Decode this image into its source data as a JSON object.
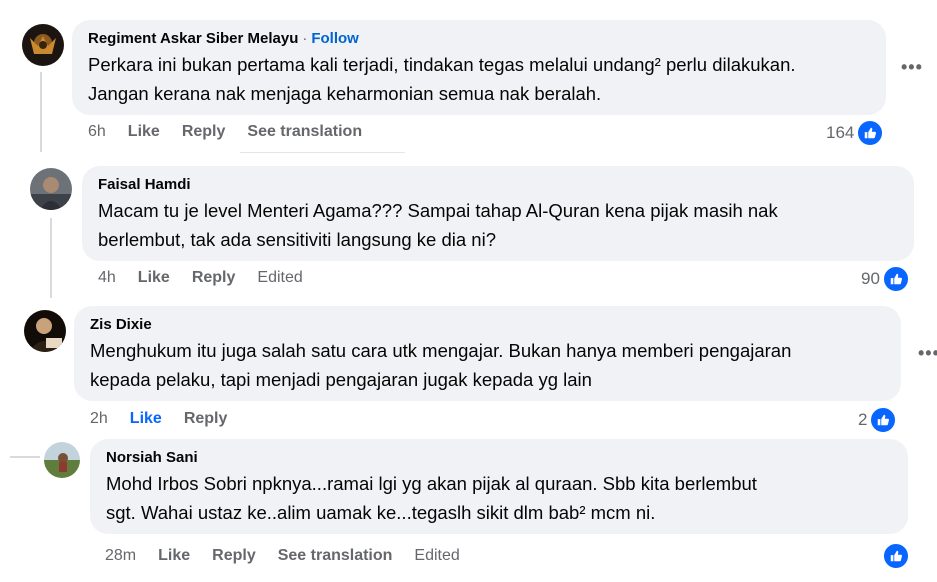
{
  "comments": [
    {
      "author": "Regiment Askar Siber Melayu",
      "follow_sep": "·",
      "follow_label": "Follow",
      "line1": "Perkara ini bukan pertama kali terjadi, tindakan tegas melalui undang² perlu dilakukan.",
      "line2": "Jangan kerana nak menjaga keharmonian semua nak beralah.",
      "time": "6h",
      "actions": [
        "Like",
        "Reply",
        "See translation"
      ],
      "reaction_count": "164",
      "more_label": "•••"
    },
    {
      "author": "Faisal Hamdi",
      "line1": "Macam tu je level Menteri Agama??? Sampai tahap Al-Quran kena pijak masih nak",
      "line2": "berlembut, tak ada sensitiviti langsung ke dia ni?",
      "time": "4h",
      "actions": [
        "Like",
        "Reply",
        "Edited"
      ],
      "reaction_count": "90"
    },
    {
      "author": "Zis Dixie",
      "line1": "Menghukum itu juga salah satu cara utk mengajar. Bukan hanya memberi pengajaran",
      "line2": "kepada pelaku, tapi menjadi pengajaran jugak kepada yg lain",
      "time": "2h",
      "actions": [
        "Like",
        "Reply"
      ],
      "reaction_count": "2",
      "more_label": "•••"
    },
    {
      "author": "Norsiah Sani",
      "line1": "Mohd Irbos Sobri npknya...ramai lgi yg akan pijak al quraan. Sbb kita berlembut",
      "line2": "sgt. Wahai ustaz ke..alim uamak ke...tegaslh sikit dlm bab² mcm ni.",
      "time": "28m",
      "actions": [
        "Like",
        "Reply",
        "See translation",
        "Edited"
      ],
      "reaction_count": ""
    }
  ],
  "colors": {
    "bubble": "#f0f2f5",
    "link_blue": "#0064d1",
    "like_blue": "#0866ff",
    "meta_gray": "#65676b"
  },
  "icons": {
    "reaction": "thumbs-up-icon",
    "more": "more-options-icon"
  }
}
